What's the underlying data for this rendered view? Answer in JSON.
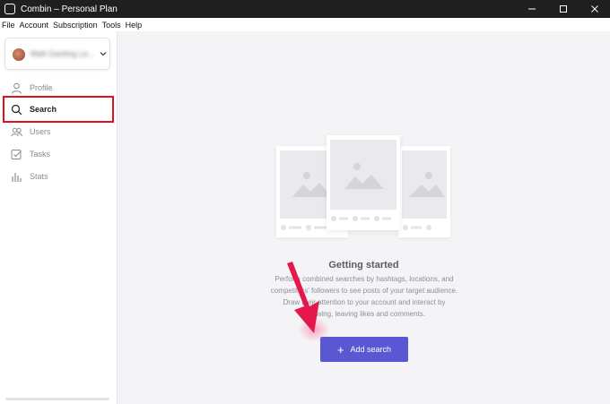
{
  "window": {
    "title": "Combin – Personal Plan",
    "controls": [
      "minimize-icon",
      "maximize-icon",
      "close-icon"
    ]
  },
  "menu": [
    "File",
    "Account",
    "Subscription",
    "Tools",
    "Help"
  ],
  "sidebar": {
    "account_name": "Matt Ganting Le...",
    "items": [
      {
        "label": "Profile",
        "icon": "profile-icon",
        "active": false
      },
      {
        "label": "Search",
        "icon": "search-icon",
        "active": true
      },
      {
        "label": "Users",
        "icon": "users-icon",
        "active": false
      },
      {
        "label": "Tasks",
        "icon": "tasks-icon",
        "active": false
      },
      {
        "label": "Stats",
        "icon": "stats-icon",
        "active": false
      }
    ]
  },
  "main": {
    "heading": "Getting started",
    "description": "Perform combined searches by hashtags, locations, and competitors' followers to see posts of your target audience. Draw their attention to your account and interact by following, leaving likes and comments.",
    "add_button": "Add search"
  },
  "colors": {
    "accent": "#5a57d2",
    "annotation_red": "#e0101e",
    "titlebar": "#1f1f1f",
    "main_bg": "#f4f4f6"
  }
}
